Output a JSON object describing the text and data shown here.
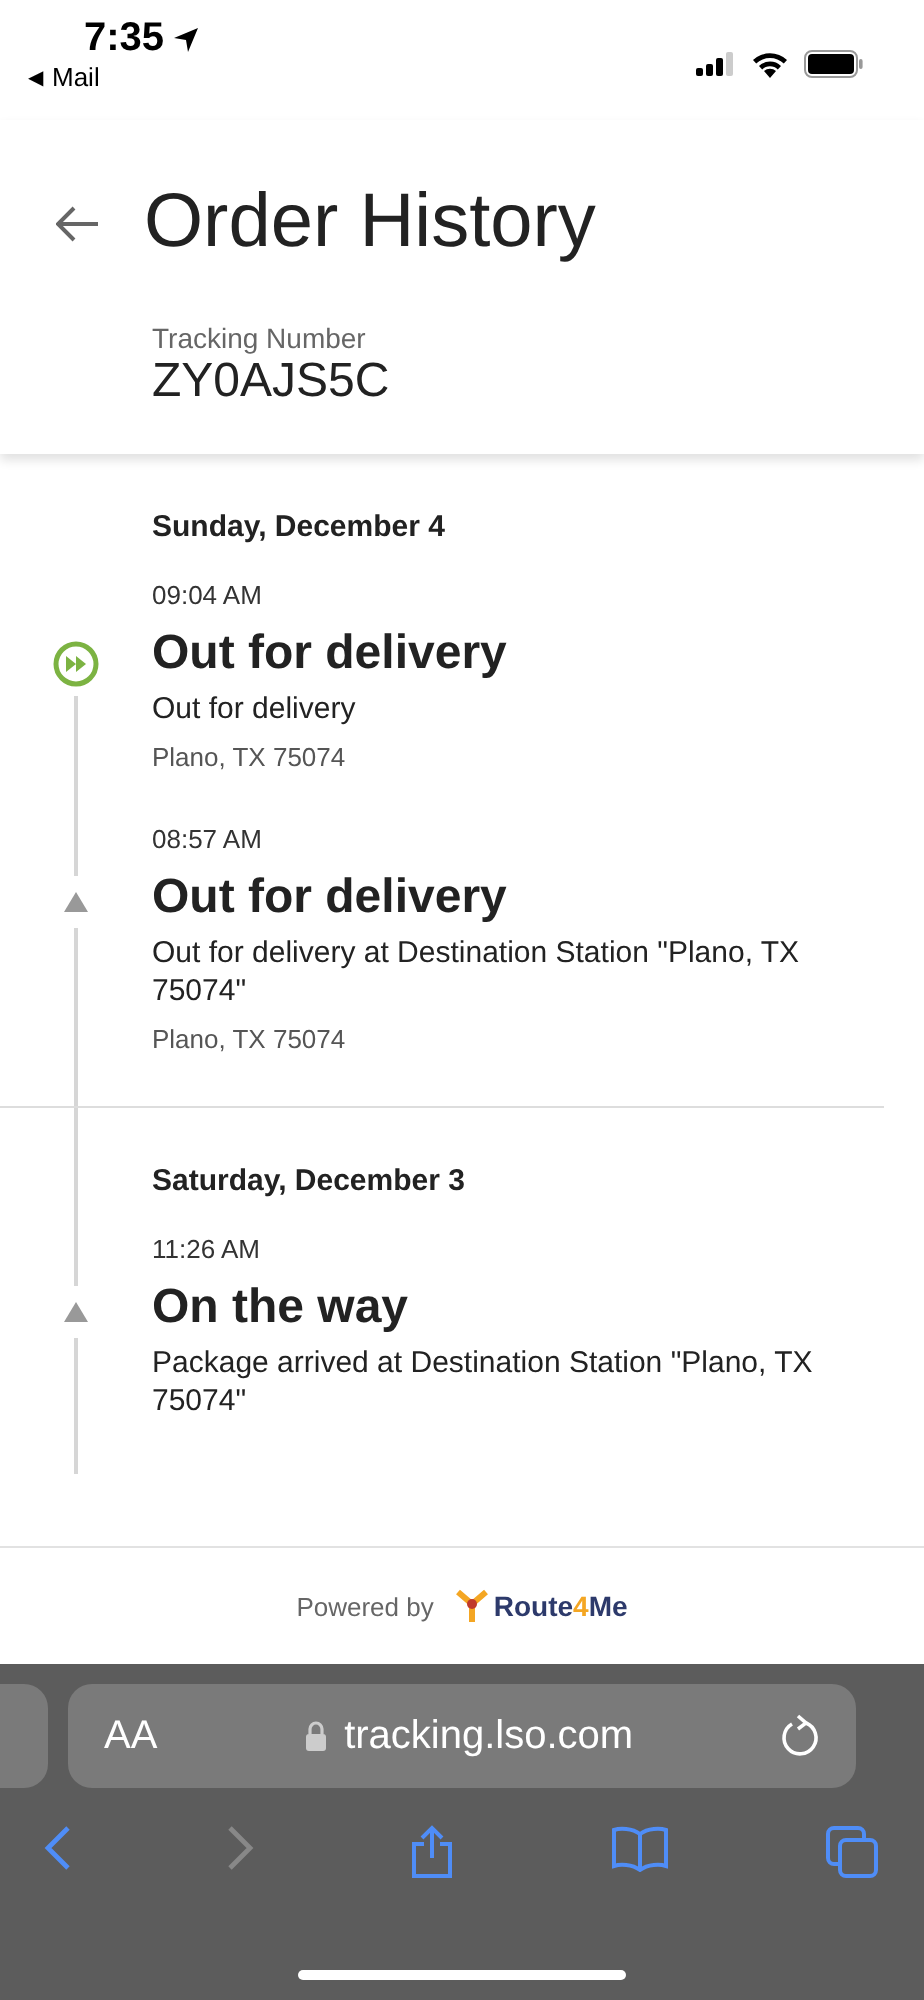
{
  "status_bar": {
    "time": "7:35",
    "back_arrow": "◀",
    "back_label": "Mail"
  },
  "header": {
    "title": "Order History",
    "tracking_label": "Tracking Number",
    "tracking_number": "ZY0AJS5C"
  },
  "days": [
    {
      "date": "Sunday, December 4",
      "events": [
        {
          "kind": "current",
          "time": "09:04 AM",
          "title": "Out for delivery",
          "description": "Out for delivery",
          "location": "Plano, TX 75074"
        },
        {
          "kind": "past",
          "time": "08:57 AM",
          "title": "Out for delivery",
          "description": "Out for delivery at Destination Station \"Plano, TX 75074\"",
          "location": "Plano, TX 75074"
        }
      ]
    },
    {
      "date": "Saturday, December 3",
      "events": [
        {
          "kind": "past",
          "time": "11:26 AM",
          "title": "On the way",
          "description": "Package arrived at Destination Station \"Plano, TX 75074\""
        }
      ]
    }
  ],
  "footer": {
    "powered_by": "Powered by",
    "logo_parts": [
      {
        "text": "Route",
        "color": "#2d3a6b"
      },
      {
        "text": "4",
        "color": "#f4a623"
      },
      {
        "text": "Me",
        "color": "#2d3a6b"
      }
    ]
  },
  "browser": {
    "text_size": "AA",
    "url": "tracking.lso.com",
    "forward_disabled": true
  }
}
